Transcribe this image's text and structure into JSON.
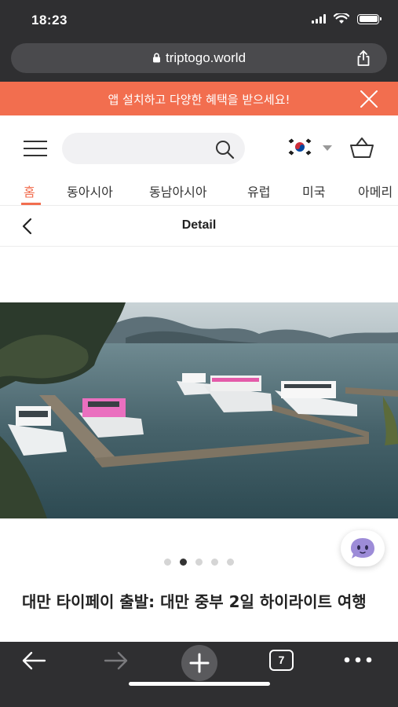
{
  "status_bar": {
    "time": "18:23"
  },
  "browser": {
    "url": "triptogo.world",
    "tab_count": "7"
  },
  "promo": {
    "text": "앱 설치하고 다양한 혜택을 받으세요!",
    "bg_color": "#f26e4f"
  },
  "header": {
    "search_placeholder": "",
    "language_flag": "korea-flag-icon"
  },
  "tabs": [
    {
      "label": "홈",
      "active": true
    },
    {
      "label": "동아시아",
      "active": false
    },
    {
      "label": "동남아시아",
      "active": false
    },
    {
      "label": "유럽",
      "active": false
    },
    {
      "label": "미국",
      "active": false
    },
    {
      "label": "아메리",
      "active": false
    }
  ],
  "detail": {
    "title": "Detail"
  },
  "carousel": {
    "total_slides": 5,
    "active_index": 1
  },
  "tour": {
    "title": "대만 타이페이 출발: 대만 중부 2일 하이라이트 여행"
  },
  "colors": {
    "accent": "#f26e4f",
    "chrome": "#2f2f31"
  }
}
